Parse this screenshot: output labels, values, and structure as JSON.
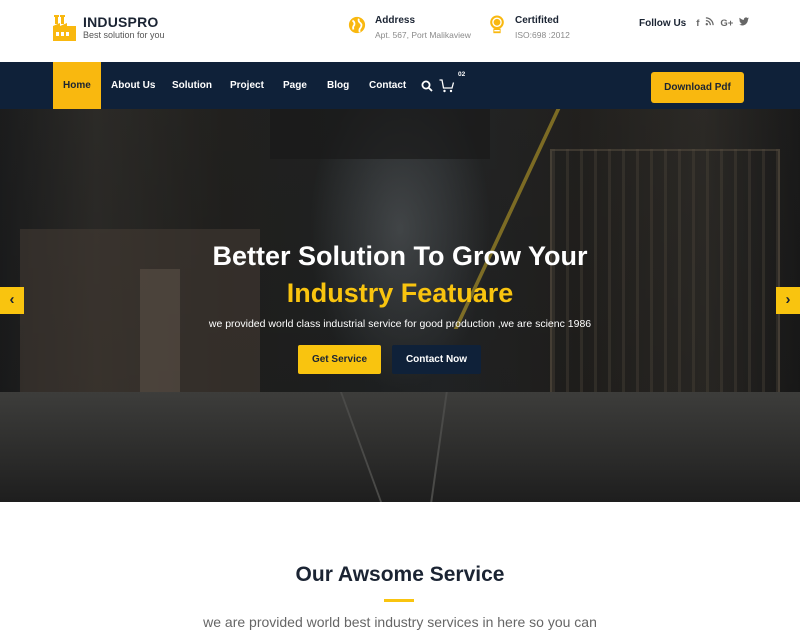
{
  "brand": {
    "name": "INDUSPRO",
    "tagline": "Best solution for you",
    "accent_color": "#f9b80f",
    "nav_color": "#0f2139"
  },
  "topbar": {
    "address": {
      "title": "Address",
      "value": "Apt. 567, Port Malikaview",
      "icon": "globe-icon"
    },
    "certified": {
      "title": "Certifited",
      "value": "ISO:698 :2012",
      "icon": "award-badge-icon"
    },
    "follow": {
      "label": "Follow Us",
      "socials": [
        {
          "name": "facebook-icon",
          "glyph": "f"
        },
        {
          "name": "rss-icon",
          "glyph": "∷"
        },
        {
          "name": "google-plus-icon",
          "glyph": "G+"
        },
        {
          "name": "twitter-icon",
          "glyph": "🐦"
        }
      ]
    }
  },
  "nav": {
    "items": [
      {
        "label": "Home",
        "active": true
      },
      {
        "label": "About Us"
      },
      {
        "label": "Solution"
      },
      {
        "label": "Project"
      },
      {
        "label": "Page"
      },
      {
        "label": "Blog"
      },
      {
        "label": "Contact"
      }
    ],
    "cart_count": "02",
    "download_label": "Download Pdf"
  },
  "hero": {
    "title_line1": "Better Solution To Grow Your",
    "title_line2": "Industry Featuare",
    "subtitle": "we provided world class industrial service for good production ,we are scienc 1986",
    "primary_button": "Get Service",
    "secondary_button": "Contact Now",
    "prev_arrow": "‹",
    "next_arrow": "›"
  },
  "services": {
    "title": "Our Awsome Service",
    "subtitle": "we are provided world best industry services in here so you can"
  }
}
